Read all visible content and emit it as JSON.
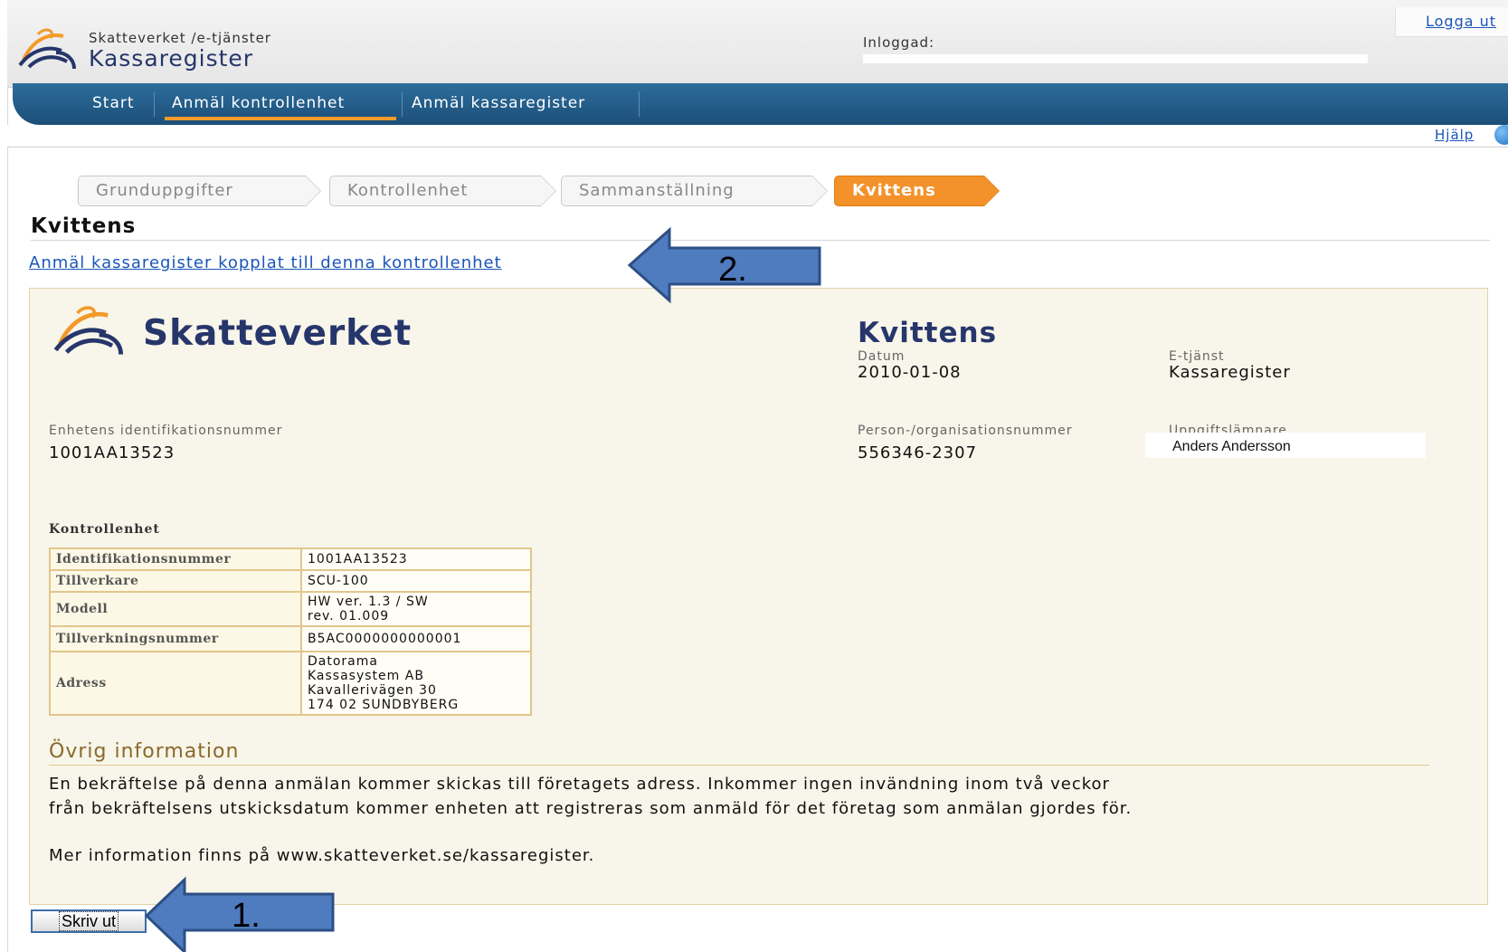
{
  "header": {
    "service_line": "Skatteverket /e-tjänster",
    "service_name": "Kassaregister",
    "logged_in_label": "Inloggad:",
    "logout_link": "Logga ut"
  },
  "nav": {
    "items": [
      "Start",
      "Anmäl kontrollenhet",
      "Anmäl kassaregister"
    ],
    "active": "Anmäl kontrollenhet"
  },
  "help_link": "Hjälp",
  "steps": [
    {
      "label": "Grunduppgifter",
      "active": false
    },
    {
      "label": "Kontrollenhet",
      "active": false
    },
    {
      "label": "Sammanställning",
      "active": false
    },
    {
      "label": "Kvittens",
      "active": true
    }
  ],
  "page_title": "Kvittens",
  "register_link": "Anmäl kassaregister kopplat till denna kontrollenhet",
  "receipt": {
    "brand": "Skatteverket",
    "title": "Kvittens",
    "date_label": "Datum",
    "date_value": "2010-01-08",
    "eservice_label": "E-tjänst",
    "eservice_value": "Kassaregister",
    "unit_id_label": "Enhetens identifikationsnummer",
    "unit_id_value": "1001AA13523",
    "orgnr_label": "Person-/organisationsnummer",
    "orgnr_value": "556346-2307",
    "submitter_label": "Uppgiftslämnare",
    "submitter_value": "Anders Andersson"
  },
  "control_unit": {
    "heading": "Kontrollenhet",
    "rows": [
      {
        "key": "Identifikationsnummer",
        "value": "1001AA13523"
      },
      {
        "key": "Tillverkare",
        "value": "SCU-100"
      },
      {
        "key": "Modell",
        "value": "HW ver. 1.3 / SW\nrev. 01.009"
      },
      {
        "key": "Tillverkningsnummer",
        "value": "B5AC0000000000001"
      },
      {
        "key": "Adress",
        "value": "Datorama\nKassasystem AB\nKavallerivägen 30\n174 02 SUNDBYBERG"
      }
    ]
  },
  "other_info": {
    "heading": "Övrig information",
    "line1": "En bekräftelse på denna anmälan kommer skickas till företagets adress. Inkommer ingen invändning inom två veckor",
    "line2": "från bekräftelsens utskicksdatum kommer enheten att registreras som anmäld för det företag som anmälan gjordes för.",
    "line3": "Mer information finns på www.skatteverket.se/kassaregister."
  },
  "print_button": "Skriv ut",
  "callouts": {
    "arrow1_label": "1.",
    "arrow2_label": "2.",
    "color": "#4f7bbf"
  }
}
